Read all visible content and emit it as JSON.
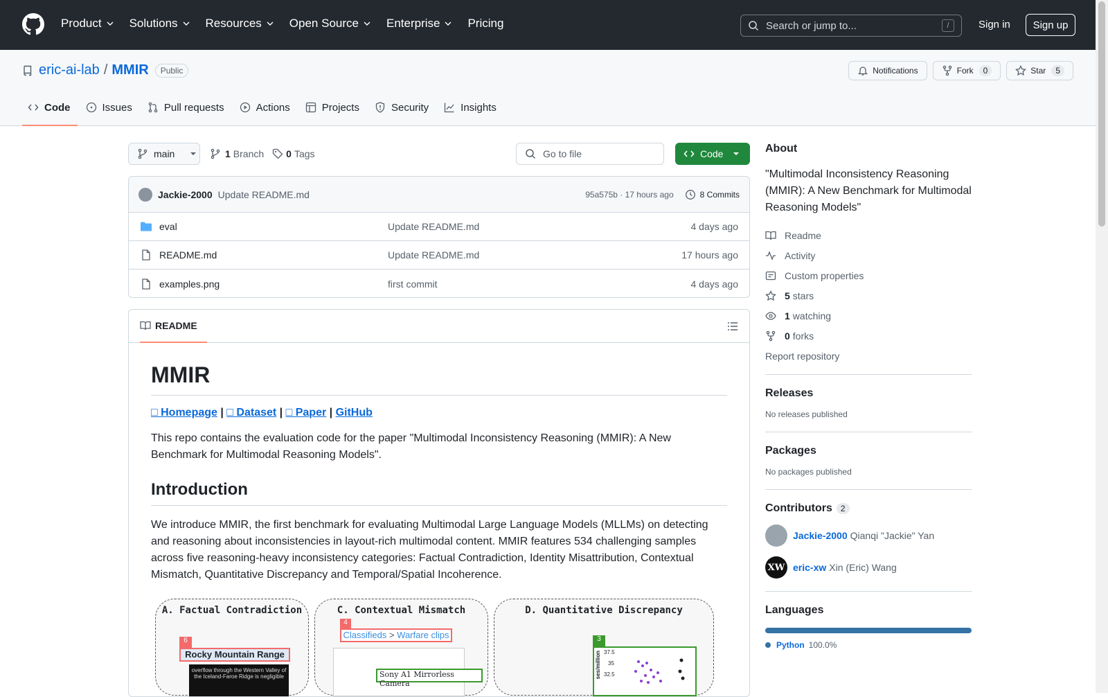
{
  "nav": {
    "menu": [
      {
        "label": "Product"
      },
      {
        "label": "Solutions"
      },
      {
        "label": "Resources"
      },
      {
        "label": "Open Source"
      },
      {
        "label": "Enterprise"
      },
      {
        "label": "Pricing"
      }
    ],
    "search_placeholder": "Search or jump to...",
    "search_key": "/",
    "sign_in": "Sign in",
    "sign_up": "Sign up"
  },
  "repo": {
    "owner": "eric-ai-lab",
    "separator": "/",
    "name": "MMIR",
    "visibility": "Public",
    "notifications": "Notifications",
    "fork_label": "Fork",
    "fork_count": "0",
    "star_label": "Star",
    "star_count": "5"
  },
  "tabs": [
    {
      "label": "Code",
      "icon": "code-icon"
    },
    {
      "label": "Issues",
      "icon": "issue-icon"
    },
    {
      "label": "Pull requests",
      "icon": "pull-request-icon"
    },
    {
      "label": "Actions",
      "icon": "play-icon"
    },
    {
      "label": "Projects",
      "icon": "table-icon"
    },
    {
      "label": "Security",
      "icon": "shield-icon"
    },
    {
      "label": "Insights",
      "icon": "graph-icon"
    }
  ],
  "toolbar": {
    "branch": "main",
    "branch_count": "1",
    "branch_label": "Branch",
    "tag_count": "0",
    "tag_label": "Tags",
    "go_to_file": "Go to file",
    "code_button": "Code"
  },
  "commit": {
    "author": "Jackie-2000",
    "message": "Update README.md",
    "hash_time": "95a575b · 17 hours ago",
    "commits": "8 Commits"
  },
  "files": [
    {
      "name": "eval",
      "type": "folder",
      "message": "Update README.md",
      "date": "4 days ago"
    },
    {
      "name": "README.md",
      "type": "file",
      "message": "Update README.md",
      "date": "17 hours ago"
    },
    {
      "name": "examples.png",
      "type": "file",
      "message": "first commit",
      "date": "4 days ago"
    }
  ],
  "readme": {
    "tab": "README",
    "title": "MMIR",
    "links": [
      "□ Homepage",
      "□ Dataset",
      "□ Paper",
      "GitHub"
    ],
    "link_sep": "|",
    "intro": "This repo contains the evaluation code for the paper \"Multimodal Inconsistency Reasoning (MMIR): A New Benchmark for Multimodal Reasoning Models\".",
    "h2": "Introduction",
    "paragraph": "We introduce MMIR, the first benchmark for evaluating Multimodal Large Language Models (MLLMs) on detecting and reasoning about inconsistencies in layout-rich multimodal content. MMIR features 534 challenging samples across five reasoning-heavy inconsistency categories: Factual Contradiction, Identity Misattribution, Contextual Mismatch, Quantitative Discrepancy and Temporal/Spatial Incoherence.",
    "figure": {
      "panelA": "A. Factual Contradiction",
      "panelA_num": "6",
      "panelA_label": "Rocky  Mountain Range",
      "panelA_text": "overflow through the Western Valley of the Iceland-Faroe Ridge is negligible",
      "panelC": "C. Contextual Mismatch",
      "panelC_num": "4",
      "panelC_label1": "Classifieds",
      "panelC_sep": ">",
      "panelC_label2": "Warfare clips",
      "panelC_text": "Sony A1 Mirrorless Camera",
      "panelD": "D. Quantitative Discrepancy",
      "panelD_num": "3",
      "panelD_ticks": [
        "37.5",
        "35",
        "32.5"
      ],
      "panelD_ylabel": "ses/million"
    }
  },
  "about": {
    "heading": "About",
    "description": "\"Multimodal Inconsistency Reasoning (MMIR): A New Benchmark for Multimodal Reasoning Models\"",
    "readme": "Readme",
    "activity": "Activity",
    "custom": "Custom properties",
    "stars_num": "5",
    "stars": "stars",
    "watching_num": "1",
    "watching": "watching",
    "forks_num": "0",
    "forks": "forks",
    "report": "Report repository"
  },
  "releases": {
    "heading": "Releases",
    "text": "No releases published"
  },
  "packages": {
    "heading": "Packages",
    "text": "No packages published"
  },
  "contributors": {
    "heading": "Contributors",
    "count": "2",
    "list": [
      {
        "login": "Jackie-2000",
        "name": "Qianqi \"Jackie\" Yan"
      },
      {
        "login": "eric-xw",
        "name": "Xin (Eric) Wang"
      }
    ]
  },
  "languages": {
    "heading": "Languages",
    "items": [
      {
        "name": "Python",
        "percent": "100.0%",
        "share": 100
      }
    ],
    "color": "#3572A5"
  }
}
